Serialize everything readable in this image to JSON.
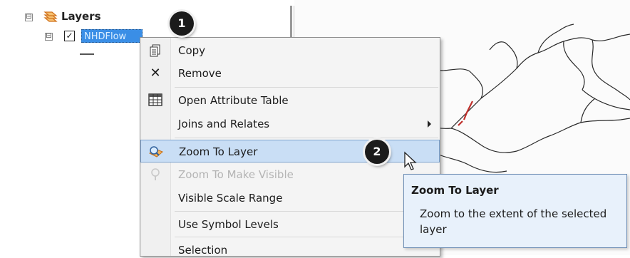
{
  "toc": {
    "root_label": "Layers",
    "layer_name": "NHDFlow",
    "root_expander": "⊟",
    "layer_expander": "⊟",
    "checkbox_mark": "✓"
  },
  "context_menu": {
    "items": [
      {
        "label": "Copy",
        "icon": "copy-icon",
        "enabled": true
      },
      {
        "label": "Remove",
        "icon": "remove-icon",
        "enabled": true
      },
      {
        "label": "Open Attribute Table",
        "icon": "table-icon",
        "enabled": true
      },
      {
        "label": "Joins and Relates",
        "icon": "",
        "enabled": true,
        "submenu": true
      },
      {
        "label": "Zoom To Layer",
        "icon": "zoom-to-layer-icon",
        "enabled": true,
        "highlighted": true
      },
      {
        "label": "Zoom To Make Visible",
        "icon": "zoom-visible-icon",
        "enabled": false
      },
      {
        "label": "Visible Scale Range",
        "icon": "",
        "enabled": true
      },
      {
        "label": "Use Symbol Levels",
        "icon": "",
        "enabled": true
      },
      {
        "label": "Selection",
        "icon": "",
        "enabled": true
      }
    ]
  },
  "callouts": {
    "first": "1",
    "second": "2"
  },
  "tooltip": {
    "title": "Zoom To Layer",
    "body": "Zoom to the extent of the selected layer"
  },
  "colors": {
    "selection_blue": "#3a8ee6",
    "hover_blue": "#c9def5",
    "tooltip_bg": "#e8f1fb",
    "layers_icon_orange": "#e88a1a",
    "map_river_red": "#c0302c"
  }
}
